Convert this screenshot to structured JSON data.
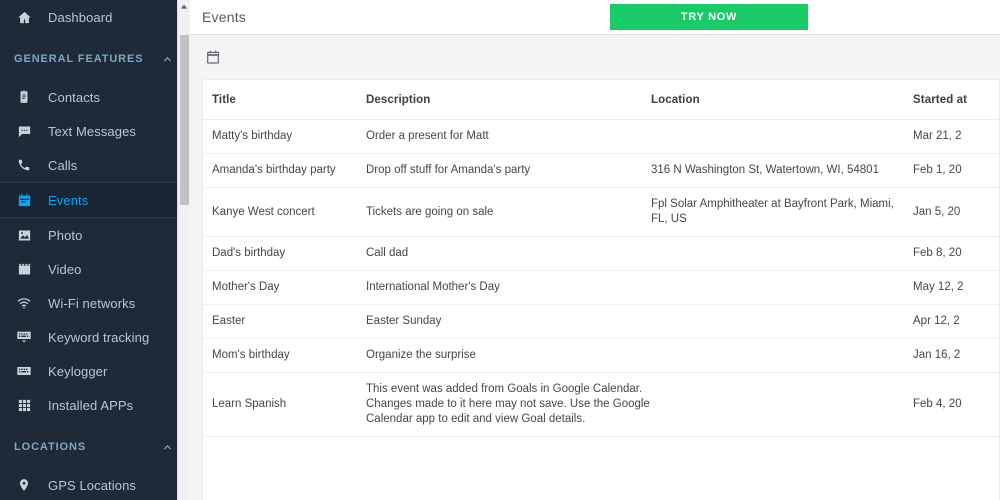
{
  "sidebar": {
    "dashboard": {
      "label": "Dashboard",
      "icon": "home-icon"
    },
    "sections": [
      {
        "key": "general",
        "label": "GENERAL FEATURES",
        "collapse_icon": "chevron-up-icon",
        "items": [
          {
            "label": "Contacts",
            "icon": "contacts-icon",
            "active": false
          },
          {
            "label": "Text Messages",
            "icon": "message-icon",
            "active": false
          },
          {
            "label": "Calls",
            "icon": "phone-icon",
            "active": false
          },
          {
            "label": "Events",
            "icon": "calendar-icon",
            "active": true
          },
          {
            "label": "Photo",
            "icon": "photo-icon",
            "active": false
          },
          {
            "label": "Video",
            "icon": "video-icon",
            "active": false
          },
          {
            "label": "Wi-Fi networks",
            "icon": "wifi-icon",
            "active": false
          },
          {
            "label": "Keyword tracking",
            "icon": "keyword-icon",
            "active": false
          },
          {
            "label": "Keylogger",
            "icon": "keyboard-icon",
            "active": false
          },
          {
            "label": "Installed APPs",
            "icon": "grid-icon",
            "active": false
          }
        ]
      },
      {
        "key": "locations",
        "label": "LOCATIONS",
        "collapse_icon": "chevron-up-icon",
        "items": [
          {
            "label": "GPS Locations",
            "icon": "pin-icon",
            "active": false
          }
        ]
      }
    ],
    "scrollbar": {
      "up_arrow": "caret-up-icon"
    }
  },
  "topbar": {
    "title": "Events",
    "try_now_label": "TRY NOW",
    "try_now_color": "#18cb67"
  },
  "content": {
    "section_icon": "calendar-icon",
    "table": {
      "columns": [
        "Title",
        "Description",
        "Location",
        "Started at"
      ],
      "rows": [
        {
          "title": "Matty's birthday",
          "description": "Order a present for Matt",
          "location": "",
          "started_at": "Mar 21, 2"
        },
        {
          "title": "Amanda's birthday party",
          "description": "Drop off stuff for Amanda's party",
          "location": "316 N Washington St, Watertown, WI, 54801",
          "started_at": "Feb 1, 20"
        },
        {
          "title": "Kanye West concert",
          "description": "Tickets are going on sale",
          "location": "Fpl Solar Amphitheater at Bayfront Park, Miami, FL, US",
          "started_at": "Jan 5, 20"
        },
        {
          "title": "Dad's birthday",
          "description": "Call dad",
          "location": "",
          "started_at": "Feb 8, 20"
        },
        {
          "title": "Mother's Day",
          "description": "International Mother's Day",
          "location": "",
          "started_at": "May 12, 2"
        },
        {
          "title": "Easter",
          "description": "Easter Sunday",
          "location": "",
          "started_at": "Apr 12, 2"
        },
        {
          "title": "Mom's birthday",
          "description": "Organize the surprise",
          "location": "",
          "started_at": "Jan 16, 2"
        },
        {
          "title": "Learn Spanish",
          "description": "This event was added from Goals in Google Calendar. Changes made to it here may not save. Use the Google Calendar app to edit and view Goal details.",
          "location": "",
          "started_at": "Feb 4, 20"
        }
      ]
    }
  },
  "colors": {
    "sidebar_bg": "#1e2a38",
    "active_text": "#0ba5f7",
    "accent_green": "#18cb67",
    "section_label": "#7fa6c4"
  }
}
